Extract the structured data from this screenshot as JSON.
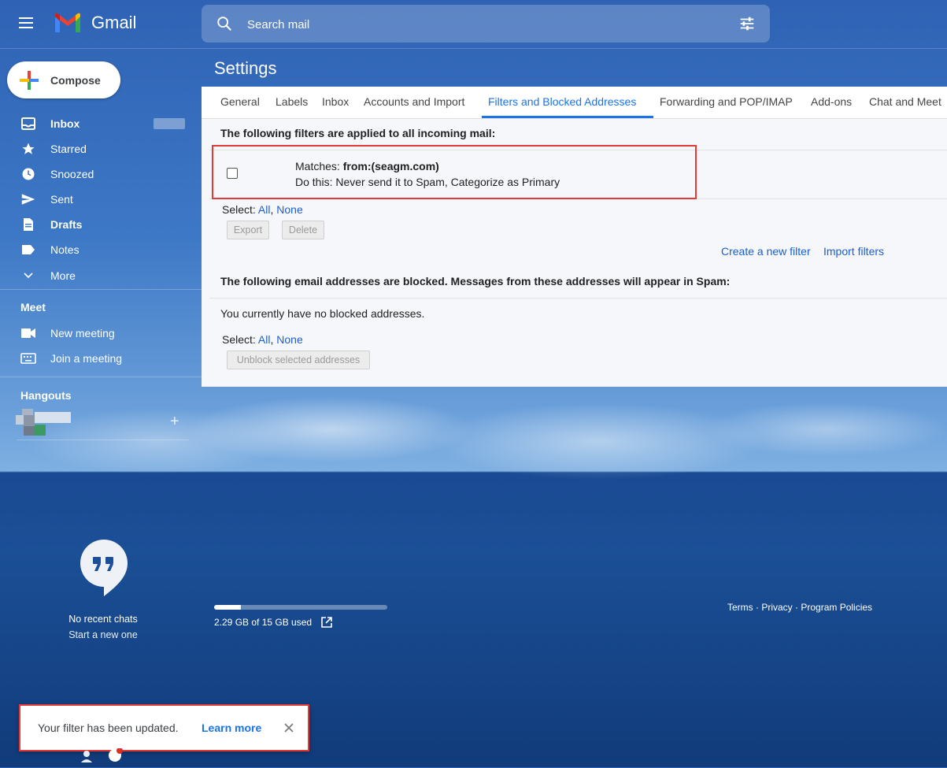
{
  "header": {
    "app_name": "Gmail",
    "search_placeholder": "Search mail"
  },
  "sidebar": {
    "compose_label": "Compose",
    "items": [
      {
        "label": "Inbox",
        "bold": true
      },
      {
        "label": "Starred"
      },
      {
        "label": "Snoozed"
      },
      {
        "label": "Sent"
      },
      {
        "label": "Drafts",
        "bold": true
      },
      {
        "label": "Notes"
      },
      {
        "label": "More"
      }
    ],
    "meet": {
      "title": "Meet",
      "items": [
        {
          "label": "New meeting"
        },
        {
          "label": "Join a meeting"
        }
      ]
    },
    "hangouts": {
      "title": "Hangouts",
      "add_symbol": "+",
      "no_chats": "No recent chats",
      "start_new": "Start a new one"
    }
  },
  "settings": {
    "title": "Settings",
    "tabs": [
      {
        "label": "General"
      },
      {
        "label": "Labels"
      },
      {
        "label": "Inbox"
      },
      {
        "label": "Accounts and Import"
      },
      {
        "label": "Filters and Blocked Addresses",
        "active": true
      },
      {
        "label": "Forwarding and POP/IMAP"
      },
      {
        "label": "Add-ons"
      },
      {
        "label": "Chat and Meet"
      }
    ],
    "filters_heading": "The following filters are applied to all incoming mail:",
    "filter": {
      "matches_prefix": "Matches: ",
      "matches_value": "from:(seagm.com)",
      "action": "Do this: Never send it to Spam, Categorize as Primary"
    },
    "select_label": "Select: ",
    "select_all": "All",
    "separator": ",",
    "select_none": "None",
    "export_label": "Export",
    "delete_label": "Delete",
    "create_filter": "Create a new filter",
    "import_filters": "Import filters",
    "blocked_heading": "The following email addresses are blocked. Messages from these addresses will appear in Spam:",
    "no_blocked": "You currently have no blocked addresses.",
    "unblock_label": "Unblock selected addresses"
  },
  "footer": {
    "storage_text": "2.29 GB of 15 GB used",
    "storage_fraction": 0.153,
    "terms": "Terms",
    "dot": " · ",
    "privacy": "Privacy",
    "program_policies": "Program Policies"
  },
  "toast": {
    "message": "Your filter has been updated.",
    "learn_more": "Learn more"
  },
  "colors": {
    "accent": "#1a73e8",
    "highlight_border": "#e53935"
  }
}
